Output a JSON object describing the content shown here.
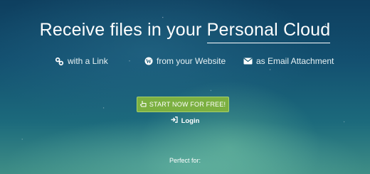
{
  "hero": {
    "title_prefix": "Receive files in your ",
    "title_accent": "Personal Cloud"
  },
  "features": [
    {
      "icon": "link-icon",
      "label": "with a Link"
    },
    {
      "icon": "wordpress-icon",
      "label": "from your Website"
    },
    {
      "icon": "envelope-icon",
      "label": "as Email Attachment"
    }
  ],
  "cta": {
    "label": "START NOW FOR FREE!",
    "icon": "hand-pointer-icon",
    "color": "#7cb041"
  },
  "login": {
    "label": "Login",
    "icon": "sign-in-icon"
  },
  "footer": {
    "perfect_for": "Perfect for:"
  }
}
